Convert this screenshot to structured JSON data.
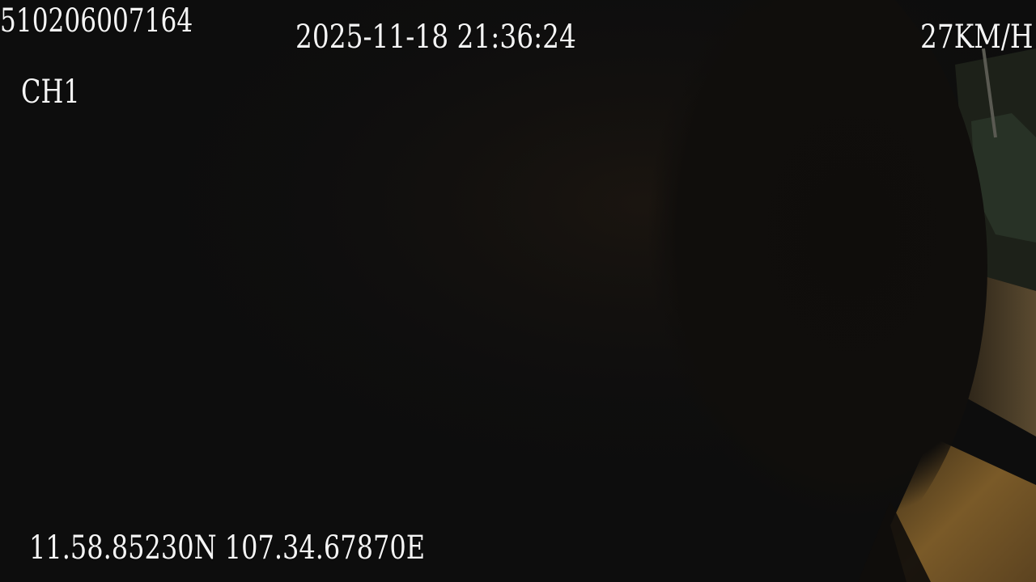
{
  "overlay": {
    "device_id": "510206007164",
    "datetime": "2025-11-18 21:36:24",
    "speed": "27KM/H",
    "channel": "CH1",
    "gps": "11.58.85230N 107.34.67870E"
  },
  "scene": {
    "description_colors": {
      "background": "#0e0e0e",
      "pavement": "#6a4f24",
      "foliage": "#3a4a3a"
    }
  }
}
